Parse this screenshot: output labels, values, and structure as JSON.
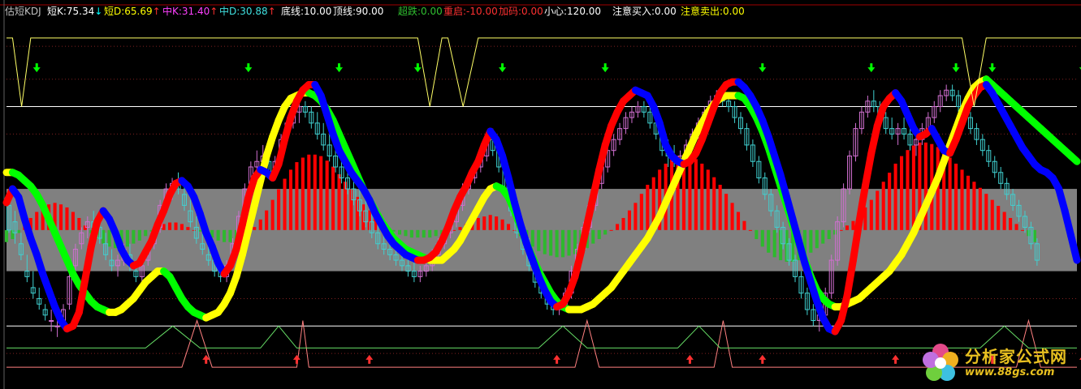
{
  "header": {
    "title": "估短KDJ",
    "items": [
      {
        "label": "短K:75.34",
        "arrow": "↓",
        "color": "#ffffff",
        "arrow_color": "#00ffff"
      },
      {
        "label": "短D:65.69",
        "arrow": "↑",
        "color": "#ffff00",
        "arrow_color": "#ff3030"
      },
      {
        "label": "中K:31.40",
        "arrow": "↑",
        "color": "#ff40ff",
        "arrow_color": "#ff3030"
      },
      {
        "label": "中D:30.88",
        "arrow": "↑",
        "color": "#40e0e0",
        "arrow_color": "#ff3030"
      },
      {
        "label": "底线:10.00",
        "color": "#ffffff"
      },
      {
        "label": "顶线:90.00",
        "color": "#ffffff"
      },
      {
        "label": "超跌:0.00",
        "color": "#30c030"
      },
      {
        "label": "重启:-10.00",
        "color": "#ff3030"
      },
      {
        "label": "加码:0.00",
        "color": "#ff3030"
      },
      {
        "label": "小心:120.00",
        "color": "#ffffff"
      },
      {
        "label": "注意买入:0.00",
        "color": "#ffffff"
      },
      {
        "label": "注意卖出:0.00",
        "color": "#ffff00"
      }
    ]
  },
  "watermark": {
    "line1": "分析家公式网",
    "line2": "www.88gs.com"
  },
  "colors": {
    "k_up": "#ff0000",
    "k_down": "#0000ff",
    "d_up": "#ffff00",
    "d_down": "#00ff00",
    "hist_pos": "#ff0000",
    "hist_neg": "#2eb82e",
    "band": "#808080",
    "candle": "#d06fd0",
    "buy_arrow": "#ff3030",
    "sell_arrow": "#00ff00",
    "top_line": "#ffff66",
    "bottom_line": "#ff8080",
    "mid_line": "#66dd66"
  },
  "chart_data": {
    "type": "line",
    "ylim": [
      -10,
      120
    ],
    "band": [
      30,
      60
    ],
    "ref_lines": [
      10,
      90
    ],
    "k_line": [
      55,
      60,
      57,
      49,
      42,
      36,
      29,
      23,
      17,
      12,
      9,
      10,
      15,
      27,
      39,
      48,
      52,
      49,
      44,
      38,
      34,
      32,
      33,
      37,
      41,
      47,
      52,
      58,
      62,
      63,
      61,
      57,
      51,
      44,
      39,
      33,
      29,
      32,
      38,
      47,
      57,
      64,
      67,
      66,
      64,
      69,
      78,
      86,
      92,
      96,
      98,
      98,
      94,
      87,
      80,
      74,
      70,
      66,
      63,
      60,
      56,
      51,
      47,
      43,
      40,
      38,
      36,
      35,
      34,
      34,
      35,
      37,
      41,
      46,
      52,
      57,
      61,
      66,
      70,
      76,
      81,
      78,
      72,
      64,
      55,
      47,
      40,
      34,
      28,
      23,
      19,
      17,
      18,
      22,
      28,
      37,
      47,
      57,
      67,
      76,
      83,
      88,
      92,
      94,
      96,
      95,
      94,
      90,
      84,
      76,
      72,
      70,
      69,
      70,
      73,
      78,
      84,
      90,
      95,
      98,
      99,
      99,
      97,
      94,
      90,
      85,
      79,
      72,
      65,
      57,
      49,
      41,
      33,
      26,
      19,
      13,
      9,
      8,
      12,
      21,
      34,
      48,
      61,
      73,
      83,
      90,
      93,
      95,
      92,
      87,
      82,
      79,
      80,
      82,
      78,
      74,
      73,
      78,
      84,
      90,
      94,
      97,
      98,
      95,
      91,
      87,
      83,
      79,
      75,
      72,
      69,
      67,
      66,
      64,
      60,
      52,
      43,
      34
    ],
    "d_line": [
      66,
      66,
      65,
      63,
      61,
      58,
      54,
      49,
      44,
      39,
      34,
      29,
      25,
      22,
      19,
      17,
      16,
      15,
      15,
      16,
      18,
      20,
      23,
      26,
      28,
      30,
      30,
      28,
      24,
      20,
      17,
      15,
      14,
      13,
      14,
      15,
      18,
      22,
      28,
      36,
      45,
      54,
      63,
      72,
      79,
      85,
      90,
      93,
      94,
      95,
      95,
      94,
      92,
      89,
      85,
      80,
      75,
      70,
      65,
      60,
      56,
      52,
      48,
      45,
      42,
      40,
      38,
      37,
      36,
      35,
      34,
      34,
      34,
      36,
      38,
      41,
      45,
      49,
      53,
      57,
      60,
      61,
      60,
      57,
      52,
      46,
      40,
      35,
      30,
      26,
      22,
      19,
      17,
      16,
      16,
      16,
      17,
      18,
      20,
      22,
      24,
      27,
      30,
      33,
      36,
      39,
      42,
      46,
      50,
      55,
      60,
      65,
      70,
      75,
      80,
      84,
      88,
      91,
      93,
      94,
      94,
      94,
      93,
      90,
      86,
      81,
      75,
      68,
      61,
      54,
      47,
      40,
      34,
      28,
      23,
      20,
      18,
      17,
      17,
      18,
      19,
      20,
      22,
      24,
      26,
      28,
      30,
      33,
      36,
      40,
      44,
      49,
      54,
      59,
      64,
      70,
      76,
      82,
      88,
      93,
      97,
      99,
      100,
      98,
      96,
      94,
      92,
      90,
      88,
      86,
      84,
      82,
      80,
      78,
      76,
      74,
      72,
      70
    ],
    "hist": [
      -8,
      -6,
      -2,
      3,
      8,
      12,
      15,
      17,
      18,
      17,
      15,
      12,
      8,
      3,
      -2,
      -6,
      -9,
      -11,
      -12,
      -12,
      -11,
      -9,
      -7,
      -4,
      -1,
      2,
      4,
      5,
      5,
      4,
      2,
      0,
      -1,
      -3,
      -5,
      -7,
      -8,
      -8,
      -7,
      -5,
      -2,
      2,
      7,
      13,
      20,
      27,
      34,
      40,
      45,
      48,
      50,
      50,
      49,
      46,
      42,
      37,
      32,
      27,
      22,
      17,
      13,
      9,
      5,
      2,
      -1,
      -3,
      -4,
      -5,
      -5,
      -5,
      -5,
      -4,
      -3,
      -2,
      0,
      2,
      4,
      6,
      8,
      9,
      10,
      9,
      7,
      4,
      0,
      -4,
      -8,
      -11,
      -14,
      -16,
      -17,
      -18,
      -18,
      -17,
      -16,
      -14,
      -12,
      -9,
      -6,
      -3,
      0,
      4,
      8,
      13,
      18,
      24,
      30,
      35,
      40,
      44,
      47,
      49,
      50,
      49,
      47,
      44,
      40,
      35,
      30,
      24,
      18,
      12,
      6,
      0,
      -6,
      -11,
      -15,
      -18,
      -20,
      -21,
      -21,
      -20,
      -18,
      -15,
      -12,
      -9,
      -6,
      -3,
      0,
      3,
      6,
      10,
      15,
      20,
      26,
      32,
      38,
      44,
      49,
      53,
      56,
      58,
      58,
      57,
      55,
      52,
      48,
      44,
      40,
      36,
      32,
      28,
      24,
      20,
      16,
      12,
      8,
      4,
      0,
      -4,
      -8
    ],
    "ohlc": [
      [
        54,
        56,
        44,
        45
      ],
      [
        48,
        52,
        40,
        44
      ],
      [
        40,
        44,
        34,
        36
      ],
      [
        30,
        36,
        26,
        28
      ],
      [
        24,
        30,
        20,
        22
      ],
      [
        20,
        24,
        16,
        18
      ],
      [
        16,
        18,
        12,
        14
      ],
      [
        12,
        16,
        8,
        12
      ],
      [
        10,
        14,
        6,
        10
      ],
      [
        12,
        18,
        10,
        16
      ],
      [
        18,
        30,
        16,
        28
      ],
      [
        32,
        40,
        30,
        38
      ],
      [
        40,
        46,
        38,
        44
      ],
      [
        46,
        50,
        42,
        48
      ],
      [
        48,
        52,
        44,
        46
      ],
      [
        46,
        50,
        40,
        42
      ],
      [
        40,
        44,
        34,
        36
      ],
      [
        34,
        38,
        30,
        32
      ],
      [
        32,
        36,
        28,
        34
      ],
      [
        34,
        40,
        32,
        38
      ],
      [
        36,
        40,
        30,
        32
      ],
      [
        30,
        34,
        26,
        28
      ],
      [
        28,
        34,
        26,
        32
      ],
      [
        34,
        40,
        32,
        38
      ],
      [
        40,
        46,
        38,
        44
      ],
      [
        46,
        56,
        44,
        54
      ],
      [
        56,
        62,
        54,
        60
      ],
      [
        60,
        64,
        56,
        62
      ],
      [
        62,
        66,
        58,
        60
      ],
      [
        58,
        62,
        52,
        54
      ],
      [
        52,
        56,
        46,
        48
      ],
      [
        46,
        50,
        40,
        42
      ],
      [
        40,
        44,
        36,
        38
      ],
      [
        36,
        40,
        32,
        34
      ],
      [
        34,
        38,
        28,
        30
      ],
      [
        30,
        34,
        26,
        28
      ],
      [
        28,
        34,
        26,
        32
      ],
      [
        34,
        42,
        32,
        40
      ],
      [
        42,
        52,
        40,
        50
      ],
      [
        52,
        62,
        50,
        60
      ],
      [
        62,
        70,
        60,
        68
      ],
      [
        68,
        74,
        64,
        70
      ],
      [
        70,
        76,
        66,
        72
      ],
      [
        70,
        74,
        64,
        66
      ],
      [
        66,
        72,
        64,
        70
      ],
      [
        72,
        80,
        70,
        78
      ],
      [
        80,
        86,
        78,
        84
      ],
      [
        84,
        90,
        82,
        88
      ],
      [
        88,
        92,
        84,
        90
      ],
      [
        90,
        92,
        86,
        88
      ],
      [
        88,
        90,
        82,
        84
      ],
      [
        84,
        88,
        78,
        80
      ],
      [
        80,
        84,
        74,
        76
      ],
      [
        76,
        80,
        70,
        72
      ],
      [
        72,
        76,
        66,
        68
      ],
      [
        68,
        72,
        62,
        64
      ],
      [
        64,
        68,
        58,
        60
      ],
      [
        60,
        64,
        54,
        56
      ],
      [
        56,
        60,
        50,
        52
      ],
      [
        52,
        56,
        46,
        48
      ],
      [
        48,
        52,
        42,
        44
      ],
      [
        44,
        48,
        38,
        40
      ],
      [
        40,
        44,
        36,
        38
      ],
      [
        38,
        42,
        34,
        36
      ],
      [
        36,
        40,
        32,
        34
      ],
      [
        34,
        38,
        30,
        32
      ],
      [
        32,
        36,
        28,
        30
      ],
      [
        30,
        34,
        26,
        28
      ],
      [
        28,
        32,
        26,
        30
      ],
      [
        30,
        34,
        28,
        32
      ],
      [
        32,
        38,
        30,
        36
      ],
      [
        36,
        42,
        34,
        40
      ],
      [
        40,
        46,
        38,
        44
      ],
      [
        44,
        50,
        42,
        48
      ],
      [
        48,
        56,
        46,
        54
      ],
      [
        54,
        62,
        52,
        60
      ],
      [
        60,
        66,
        58,
        64
      ],
      [
        64,
        70,
        62,
        68
      ],
      [
        68,
        74,
        66,
        72
      ],
      [
        72,
        80,
        70,
        78
      ],
      [
        78,
        82,
        72,
        74
      ],
      [
        74,
        78,
        66,
        68
      ],
      [
        68,
        72,
        58,
        60
      ],
      [
        60,
        64,
        50,
        52
      ],
      [
        52,
        56,
        42,
        44
      ],
      [
        44,
        48,
        36,
        38
      ],
      [
        38,
        42,
        30,
        32
      ],
      [
        32,
        36,
        24,
        26
      ],
      [
        26,
        30,
        20,
        22
      ],
      [
        22,
        26,
        16,
        18
      ],
      [
        18,
        22,
        14,
        16
      ],
      [
        16,
        20,
        14,
        18
      ],
      [
        18,
        24,
        16,
        22
      ],
      [
        22,
        32,
        20,
        30
      ],
      [
        30,
        40,
        28,
        38
      ],
      [
        38,
        48,
        36,
        46
      ],
      [
        46,
        56,
        44,
        54
      ],
      [
        54,
        64,
        52,
        62
      ],
      [
        62,
        70,
        60,
        68
      ],
      [
        68,
        76,
        66,
        74
      ],
      [
        74,
        80,
        72,
        78
      ],
      [
        78,
        84,
        76,
        82
      ],
      [
        82,
        88,
        80,
        86
      ],
      [
        86,
        90,
        84,
        88
      ],
      [
        88,
        92,
        86,
        90
      ],
      [
        90,
        92,
        86,
        88
      ],
      [
        88,
        90,
        82,
        84
      ],
      [
        84,
        88,
        78,
        80
      ],
      [
        80,
        82,
        72,
        74
      ],
      [
        74,
        78,
        68,
        72
      ],
      [
        72,
        76,
        68,
        70
      ],
      [
        70,
        74,
        66,
        72
      ],
      [
        72,
        78,
        70,
        76
      ],
      [
        76,
        82,
        74,
        80
      ],
      [
        80,
        86,
        78,
        84
      ],
      [
        84,
        90,
        82,
        88
      ],
      [
        88,
        94,
        86,
        92
      ],
      [
        92,
        96,
        90,
        94
      ],
      [
        94,
        96,
        90,
        92
      ],
      [
        92,
        94,
        88,
        90
      ],
      [
        90,
        92,
        84,
        86
      ],
      [
        86,
        88,
        80,
        82
      ],
      [
        82,
        84,
        74,
        76
      ],
      [
        76,
        78,
        68,
        70
      ],
      [
        70,
        72,
        62,
        64
      ],
      [
        64,
        66,
        56,
        58
      ],
      [
        58,
        60,
        50,
        52
      ],
      [
        52,
        54,
        44,
        46
      ],
      [
        46,
        48,
        38,
        40
      ],
      [
        40,
        42,
        32,
        34
      ],
      [
        34,
        36,
        26,
        28
      ],
      [
        28,
        30,
        20,
        22
      ],
      [
        22,
        24,
        14,
        16
      ],
      [
        16,
        18,
        10,
        12
      ],
      [
        12,
        16,
        8,
        14
      ],
      [
        14,
        24,
        12,
        22
      ],
      [
        22,
        36,
        20,
        34
      ],
      [
        34,
        50,
        32,
        48
      ],
      [
        48,
        62,
        46,
        60
      ],
      [
        60,
        74,
        58,
        72
      ],
      [
        72,
        84,
        70,
        82
      ],
      [
        82,
        90,
        80,
        88
      ],
      [
        88,
        94,
        86,
        92
      ],
      [
        92,
        96,
        88,
        90
      ],
      [
        90,
        92,
        84,
        86
      ],
      [
        86,
        88,
        80,
        82
      ],
      [
        82,
        86,
        78,
        80
      ],
      [
        80,
        84,
        76,
        82
      ],
      [
        82,
        86,
        78,
        80
      ],
      [
        80,
        84,
        74,
        76
      ],
      [
        76,
        80,
        72,
        78
      ],
      [
        78,
        84,
        76,
        82
      ],
      [
        82,
        88,
        80,
        86
      ],
      [
        86,
        92,
        84,
        90
      ],
      [
        90,
        96,
        88,
        94
      ],
      [
        94,
        98,
        92,
        96
      ],
      [
        96,
        98,
        92,
        94
      ],
      [
        94,
        96,
        88,
        90
      ],
      [
        90,
        92,
        84,
        86
      ],
      [
        86,
        88,
        80,
        82
      ],
      [
        82,
        84,
        76,
        78
      ],
      [
        78,
        80,
        72,
        74
      ],
      [
        74,
        76,
        68,
        70
      ],
      [
        70,
        72,
        64,
        66
      ],
      [
        66,
        68,
        60,
        62
      ],
      [
        62,
        64,
        56,
        58
      ],
      [
        58,
        60,
        52,
        54
      ],
      [
        54,
        56,
        48,
        50
      ],
      [
        50,
        52,
        44,
        46
      ],
      [
        46,
        48,
        38,
        40
      ],
      [
        40,
        42,
        32,
        34
      ]
    ],
    "sell_arrows": [
      5,
      40,
      55,
      68,
      82,
      99,
      125,
      143,
      157,
      163,
      178
    ],
    "buy_arrows": [
      33,
      48,
      60,
      91,
      113,
      125,
      147,
      163,
      178
    ],
    "top_dips": [
      [
        1,
        4
      ],
      [
        68,
        72
      ],
      [
        73,
        78
      ],
      [
        158,
        162
      ],
      [
        217,
        221
      ]
    ],
    "bottom_spikes": [
      [
        29,
        34
      ],
      [
        48,
        50
      ],
      [
        94,
        98
      ],
      [
        117,
        120
      ],
      [
        167,
        171
      ]
    ]
  }
}
